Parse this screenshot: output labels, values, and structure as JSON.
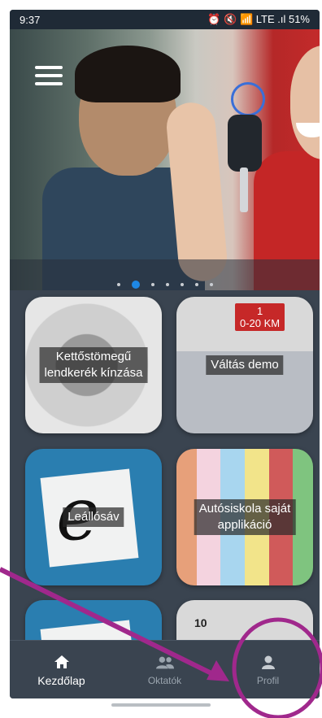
{
  "status_bar": {
    "time": "9:37",
    "indicators": "⏰ 🔇 📶 LTE .ıl",
    "battery": "51%"
  },
  "hero": {
    "menu_icon": "hamburger-menu-icon",
    "carousel_dots": 7,
    "active_dot": 1
  },
  "tiles": [
    {
      "label": "Kettőstömegű\nlendkerék kínzása"
    },
    {
      "label": "Váltás demo",
      "badge": "1\n0-20 KM"
    },
    {
      "label": "Leállósáv"
    },
    {
      "label": "Autósiskola saját\napplikáció"
    },
    {
      "label": ""
    },
    {
      "label": "",
      "number": "10"
    }
  ],
  "nav": {
    "items": [
      {
        "label": "Kezdőlap",
        "icon": "home-icon",
        "active": true
      },
      {
        "label": "Oktatók",
        "icon": "people-icon",
        "active": false
      },
      {
        "label": "Profil",
        "icon": "person-icon",
        "active": false
      }
    ]
  },
  "colors": {
    "background": "#3a4450",
    "accent": "#1e88e5",
    "annotation": "#a0288c"
  }
}
